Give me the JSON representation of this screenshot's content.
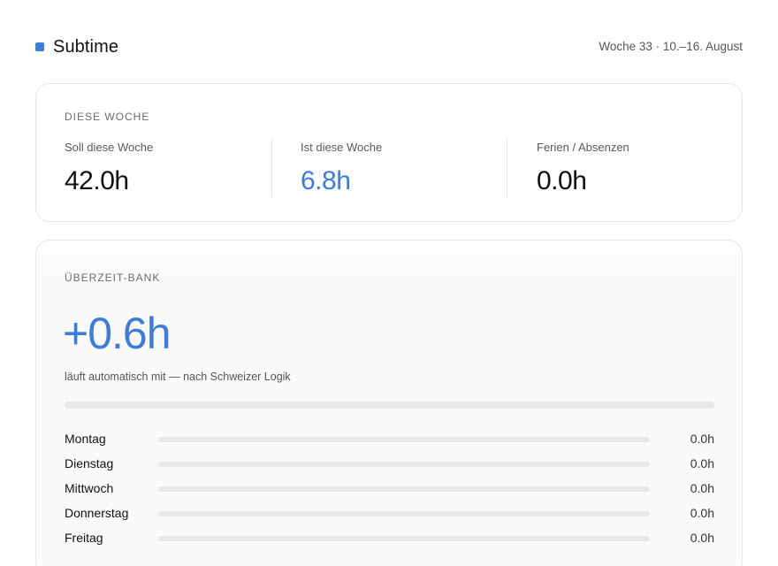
{
  "header": {
    "app_name": "Subtime",
    "week_label": "Woche 33 · 10.–16. August"
  },
  "week_summary": {
    "title": "DIESE WOCHE",
    "stats": [
      {
        "label": "Soll diese Woche",
        "value": "42.0h"
      },
      {
        "label": "Ist diese Woche",
        "value": "6.8h"
      },
      {
        "label": "Ferien / Absenzen",
        "value": "0.0h"
      }
    ]
  },
  "overtime_bank": {
    "title": "ÜBERZEIT-BANK",
    "value": "+0.6h",
    "caption": "läuft automatisch mit — nach Schweizer Logik",
    "progress_fraction": 0,
    "days": [
      {
        "name": "Montag",
        "value": "0.0h",
        "progress_fraction": 0
      },
      {
        "name": "Dienstag",
        "value": "0.0h",
        "progress_fraction": 0
      },
      {
        "name": "Mittwoch",
        "value": "0.0h",
        "progress_fraction": 0
      },
      {
        "name": "Donnerstag",
        "value": "0.0h",
        "progress_fraction": 0
      },
      {
        "name": "Freitag",
        "value": "0.0h",
        "progress_fraction": 0
      }
    ]
  },
  "colors": {
    "accent": "#3b7ddd",
    "track": "#e8e8e8",
    "text": "#111111",
    "muted": "#5a5a5a"
  }
}
